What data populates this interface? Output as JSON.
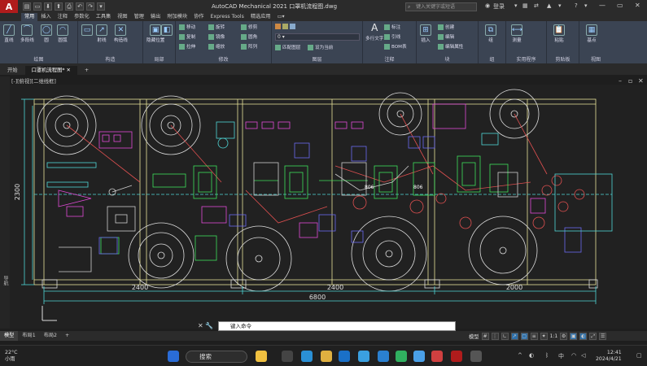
{
  "app": {
    "logo": "A",
    "title": "AutoCAD Mechanical 2021    口罩机流程图.dwg",
    "search_placeholder": "键入关键字或短语",
    "login": "登录",
    "qat": [
      "▤",
      "▭",
      "⬇",
      "⬆",
      "⎙",
      "↶",
      "↷",
      "▾"
    ]
  },
  "ribbon_tabs": [
    "常用",
    "插入",
    "注释",
    "参数化",
    "工具集",
    "视图",
    "管理",
    "输出",
    "附加模块",
    "协作",
    "Express Tools",
    "精选应用",
    "▭▾"
  ],
  "ribbon": {
    "draw_panel": "绘图",
    "line": "直线",
    "polyline": "多段线",
    "circle": "圆",
    "arc": "圆弧",
    "construction": "构造",
    "construction_tools": [
      "射线",
      "构造线"
    ],
    "modify_panel": "修改",
    "modify_tools": [
      [
        "移动",
        "旋转",
        "修剪"
      ],
      [
        "复制",
        "镜像",
        "圆角"
      ],
      [
        "拉伸",
        "缩放",
        "阵列"
      ]
    ],
    "hide_tools": [
      "隐藏位置",
      "隐藏"
    ],
    "local_panel": "局部",
    "layers_panel": "图层",
    "layer_name": "0",
    "layer_tools": [
      "匹配图层",
      "设为当前",
      "置为另一图层"
    ],
    "annotation_panel": "注释",
    "text": "多行文字",
    "dims": [
      "标注",
      "引线",
      "BOM表"
    ],
    "insert": "插入",
    "block_panel": "块",
    "block_tools": [
      "创建",
      "编辑",
      "编辑属性"
    ],
    "group": "组",
    "group_panel": "组",
    "measure": "测量",
    "utilities_panel": "实用程序",
    "paste": "粘贴",
    "clipboard_panel": "剪贴板",
    "base": "基点",
    "view_panel": "视图"
  },
  "doc_tabs": [
    "开始",
    "口罩机流程图*",
    "+"
  ],
  "viewport_label": "[-][俯视][二维线框]",
  "nav_label": "导航",
  "drawing": {
    "dims_top": [
      "2400",
      "2400",
      "2000"
    ],
    "dim_total": "6800",
    "dim_vertical": "2300",
    "labels": [
      "806",
      "806"
    ]
  },
  "cmd_prompt": "键入命令",
  "layout_tabs": [
    "模型",
    "布局1",
    "布局2",
    "+"
  ],
  "status": {
    "model": "模型",
    "scale": "1:1"
  },
  "taskbar": {
    "temp": "22°C",
    "cond": "小雨",
    "search": "搜索",
    "ime": "中",
    "time": "12:41",
    "date": "2024/4/21"
  },
  "colors": {
    "accent": "#2e6fa8",
    "autocad_red": "#b01c1c",
    "frame_yellow": "#e9e49a",
    "dim_cyan": "#4fd6d6"
  }
}
